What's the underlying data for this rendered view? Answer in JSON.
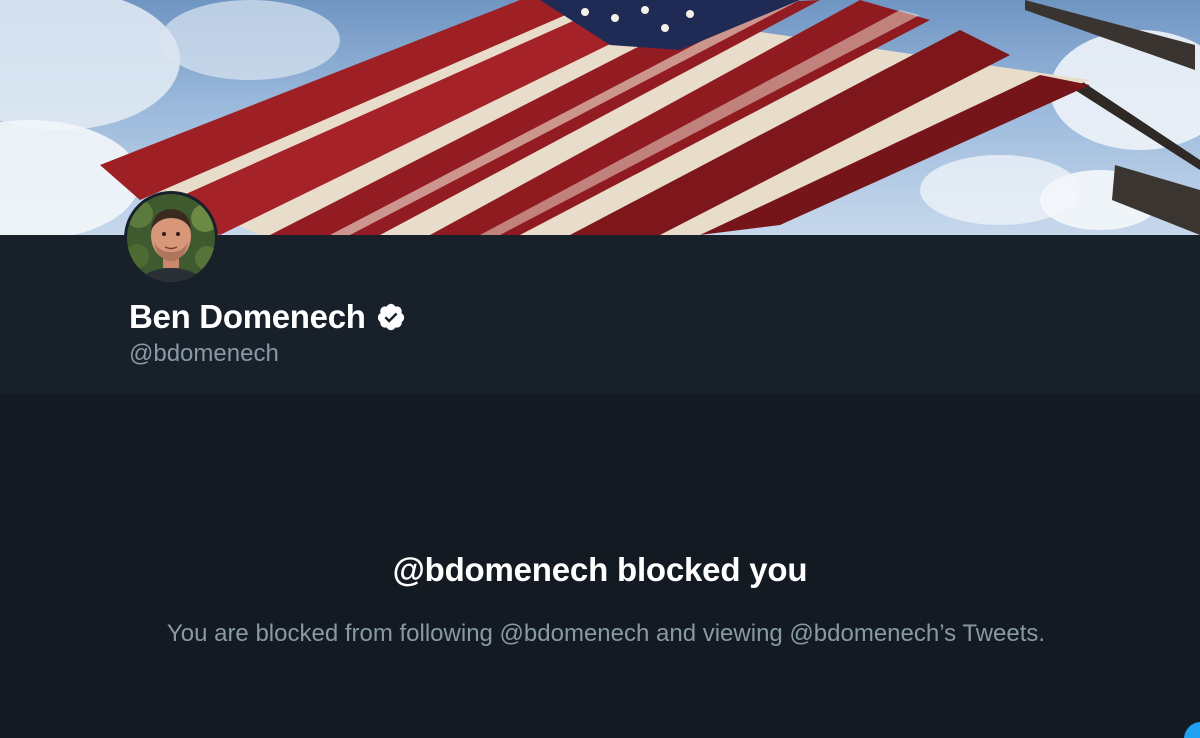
{
  "profile": {
    "display_name": "Ben Domenech",
    "handle": "@bdomenech",
    "verified": true
  },
  "blocked": {
    "title": "@bdomenech blocked you",
    "description": "You are blocked from following @bdomenech and viewing @bdomenech’s Tweets."
  },
  "colors": {
    "header_bg": "#18202a",
    "page_bg": "#131a22",
    "secondary_text": "#8899a6",
    "primary_text": "#ffffff",
    "accent": "#1da1f2"
  },
  "icons": {
    "verified": "verified-badge-icon",
    "banner": "american-flag-image",
    "avatar": "profile-photo"
  }
}
